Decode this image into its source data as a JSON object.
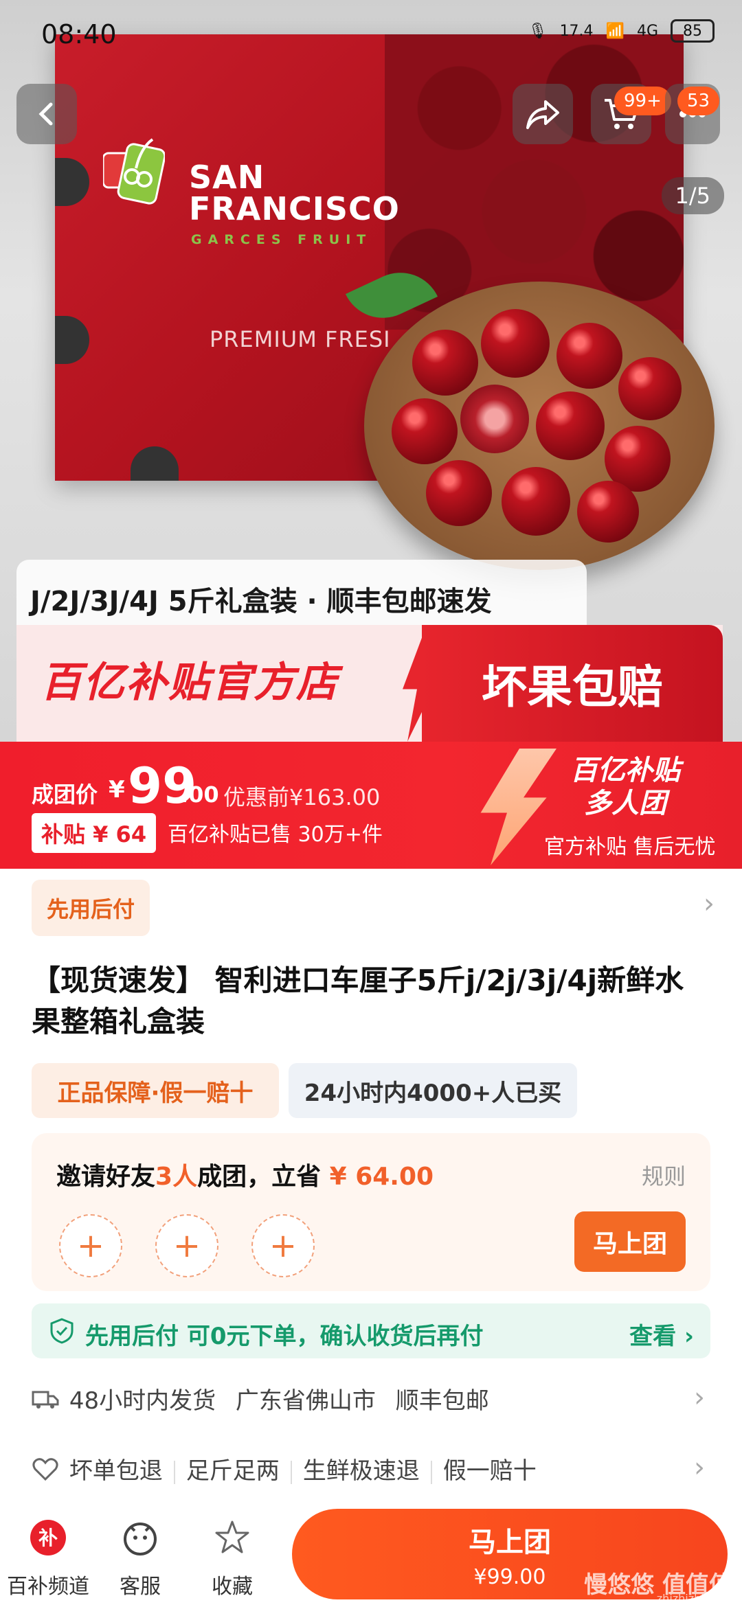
{
  "status_bar": {
    "time": "08:40",
    "network_speed": "17.4",
    "signal": "4G",
    "battery": "85"
  },
  "top_nav": {
    "cart_badge": "99+",
    "more_badge": "53",
    "image_counter": "1/5"
  },
  "hero": {
    "brand_line1": "SAN",
    "brand_line2": "FRANCISCO",
    "brand_sub": "GARCES FRUIT",
    "brand_premium": "PREMIUM FRESI",
    "promo_line": "J/2J/3J/4J 5斤礼盒装 · 顺丰包邮速发",
    "promo_left": "百亿补贴官方店",
    "promo_right": "坏果包赔"
  },
  "price": {
    "label": "成团价",
    "yen": "¥",
    "amount_int": "99",
    "amount_dec": ".00",
    "original": "优惠前¥163.00",
    "subsidy_tag": "补贴 ¥ 64",
    "sold": "百亿补贴已售 30万+件",
    "right_title_1": "百亿补贴",
    "right_title_2": "多人团",
    "right_sub": "官方补贴 售后无忧"
  },
  "pay_later_tag": "先用后付",
  "product_title": "【现货速发】 智利进口车厘子5斤j/2j/3j/4j新鲜水果整箱礼盒装",
  "tags": {
    "guarantee": "正品保障·假一赔十",
    "bought": "24小时内4000+人已买"
  },
  "group": {
    "text_pre": "邀请好友",
    "text_hl": "3人",
    "text_mid": "成团，立省",
    "text_amount": " ¥ 64.00",
    "rule": "规则",
    "plus": "+",
    "join": "马上团"
  },
  "pay_later_banner": {
    "text": "先用后付 可0元下单，确认收货后再付",
    "more": "查看 ›"
  },
  "shipping": {
    "time": "48小时内发货",
    "place": "广东省佛山市",
    "carrier": "顺丰包邮"
  },
  "services": [
    "坏单包退",
    "足斤足两",
    "生鲜极速退",
    "假一赔十"
  ],
  "bottom_bar": {
    "channel": "百补频道",
    "service": "客服",
    "favorite": "收藏",
    "cta_title": "马上团",
    "cta_price": "¥99.00"
  },
  "watermark": {
    "text": "慢悠悠 值值值",
    "url": "zhizhizhi.com"
  },
  "colors": {
    "accent_red": "#f01e2c",
    "accent_orange": "#f36a25",
    "pay_later_green": "#159a6b"
  }
}
